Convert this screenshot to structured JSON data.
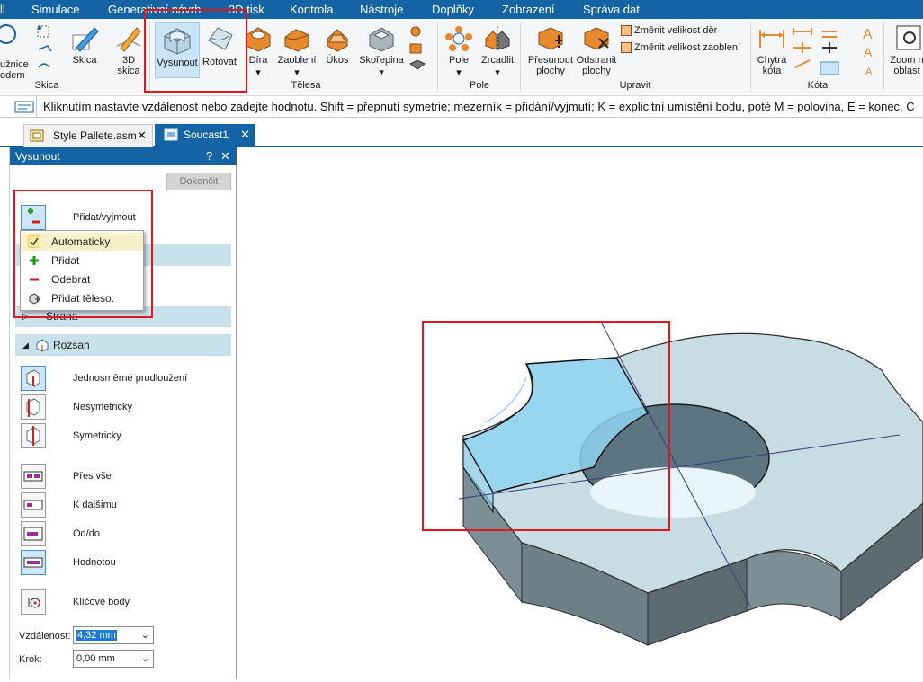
{
  "menu": [
    "ll",
    "Simulace",
    "Generativní návrh",
    "3D tisk",
    "Kontrola",
    "Nástroje",
    "Doplňky",
    "Zobrazení",
    "Správa dat"
  ],
  "ribbon": {
    "sketch_group": {
      "label": "Skica",
      "partial_left_label": "užnice\nodem",
      "skica": "Skica",
      "skica3d": "3D\nskica"
    },
    "body_group": {
      "label": "Tělesa",
      "vysunout": "Vysunout",
      "rotovat": "Rotovat",
      "dira": "Díra",
      "zaobleni": "Zaoblení",
      "ukos": "Úkos",
      "skorepina": "Skořepina"
    },
    "pattern_group": {
      "label": "Pole",
      "pole": "Pole",
      "zrcadlit": "Zrcadlit"
    },
    "modify_group": {
      "label": "Upravit",
      "presunout": "Přesunout\nplochy",
      "odstranit": "Odstranit\nplochy",
      "zmenit_der": "Změnit velikost děr",
      "zmenit_zaobleni": "Změnit velikost zaoblení"
    },
    "dim_group": {
      "label": "Kóta",
      "chytra": "Chytrá\nkóta"
    },
    "view_group": {
      "zoom": "Zoom n\noblast"
    }
  },
  "prompt": "Kliknutím nastavte vzdálenost nebo zadejte hodnotu. Shift = přepnutí symetrie; mezerník = přidání/vyjmutí; K = explicitní umístění bodu, poté M = polovina, E = konec, C",
  "tabs": [
    {
      "label": "Style Pallete.asm",
      "active": false,
      "close": "✕"
    },
    {
      "label": "Soucast1",
      "active": true,
      "close": "✕"
    }
  ],
  "panel": {
    "title": "Vysunout",
    "help": "?",
    "close": "✕",
    "finish_button": "Dokončit",
    "add_remove": "Přidat/vyjmout",
    "dropdown": [
      {
        "label": "Automaticky",
        "icon": "check-icon"
      },
      {
        "label": "Přidat",
        "icon": "plus-icon"
      },
      {
        "label": "Odebrat",
        "icon": "minus-icon"
      },
      {
        "label": "Přidat těleso.",
        "icon": "add-body-icon"
      }
    ],
    "side_section": "Strana",
    "extent_section": "Rozsah",
    "direction_options": [
      "Jednosměrné prodloužení",
      "Nesymetricky",
      "Symetricky"
    ],
    "extent_options": [
      "Přes vše",
      "K dalšímu",
      "Od/do",
      "Hodnotou"
    ],
    "keypoints": "Klíčové body",
    "distance_label": "Vzdálenost:",
    "distance_value": "4,32 mm",
    "step_label": "Krok:",
    "step_value": "0,00 mm"
  },
  "colors": {
    "accent": "#1464a5",
    "highlight": "#e8141c",
    "section": "#c9e1ea",
    "part_top": "#c7dde3",
    "part_side": "#7a9099",
    "preview_blue": "#8fd3f0"
  }
}
